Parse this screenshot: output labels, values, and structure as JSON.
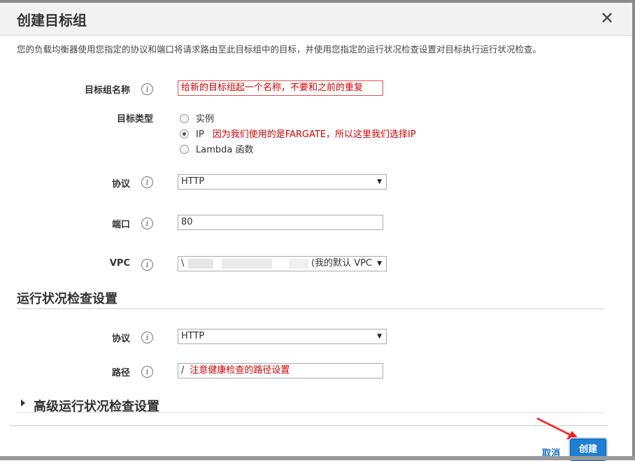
{
  "dialog": {
    "title": "创建目标组",
    "close_glyph": "✕",
    "description": "您的负载均衡器使用您指定的协议和端口将请求路由至此目标组中的目标，并使用您指定的运行状况检查设置对目标执行运行状况检查。"
  },
  "form": {
    "name_label": "目标组名称",
    "name_value": "给新的目标组起一个名称，不要和之前的重复",
    "target_type_label": "目标类型",
    "target_options": [
      {
        "label": "实例",
        "selected": false,
        "annotation": ""
      },
      {
        "label": "IP",
        "selected": true,
        "annotation": "因为我们使用的是FARGATE，所以这里我们选择IP"
      },
      {
        "label": "Lambda 函数",
        "selected": false,
        "annotation": ""
      }
    ],
    "protocol_label": "协议",
    "protocol_value": "HTTP",
    "port_label": "端口",
    "port_value": "80",
    "vpc_label": "VPC",
    "vpc_value": "\\",
    "vpc_suffix": "(我的默认 VPC"
  },
  "health": {
    "section_title": "运行状况检查设置",
    "protocol_label": "协议",
    "protocol_value": "HTTP",
    "path_label": "路径",
    "path_value": "/",
    "path_annotation": "注意健康检查的路径设置"
  },
  "advanced": {
    "section_title": "高级运行状况检查设置"
  },
  "footer": {
    "cancel_label": "取消",
    "create_label": "创建"
  },
  "colors": {
    "primary_button": "#1f7fd0",
    "annotation": "#d00000",
    "arrow": "#ff1a1a"
  },
  "info_glyph": "i",
  "select_arrow": "▼"
}
